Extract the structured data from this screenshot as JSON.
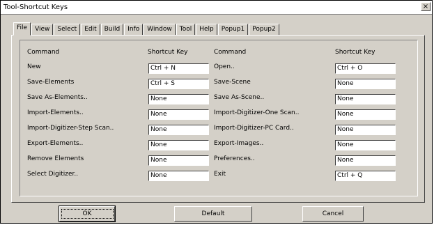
{
  "window": {
    "title": "Tool-Shortcut Keys",
    "close_glyph": "×"
  },
  "tabs": [
    "File",
    "View",
    "Select",
    "Edit",
    "Build",
    "Info",
    "Window",
    "Tool",
    "Help",
    "Popup1",
    "Popup2"
  ],
  "headers": {
    "command": "Command",
    "shortcut": "Shortcut Key"
  },
  "left_commands": [
    {
      "label": "New",
      "key": "Ctrl + N"
    },
    {
      "label": "Save-Elements",
      "key": "Ctrl + S"
    },
    {
      "label": "Save As-Elements..",
      "key": "None"
    },
    {
      "label": "Import-Elements..",
      "key": "None"
    },
    {
      "label": "Import-Digitizer-Step Scan..",
      "key": "None"
    },
    {
      "label": "Export-Elements..",
      "key": "None"
    },
    {
      "label": "Remove Elements",
      "key": "None"
    },
    {
      "label": "Select Digitizer..",
      "key": "None"
    }
  ],
  "right_commands": [
    {
      "label": "Open..",
      "key": "Ctrl + O"
    },
    {
      "label": "Save-Scene",
      "key": "None"
    },
    {
      "label": "Save As-Scene..",
      "key": "None"
    },
    {
      "label": "Import-Digitizer-One Scan..",
      "key": "None"
    },
    {
      "label": "Import-Digitizer-PC Card..",
      "key": "None"
    },
    {
      "label": "Export-Images..",
      "key": "None"
    },
    {
      "label": "Preferences..",
      "key": "None"
    },
    {
      "label": "Exit",
      "key": "Ctrl + Q"
    }
  ],
  "buttons": {
    "ok": "OK",
    "default": "Default",
    "cancel": "Cancel"
  }
}
